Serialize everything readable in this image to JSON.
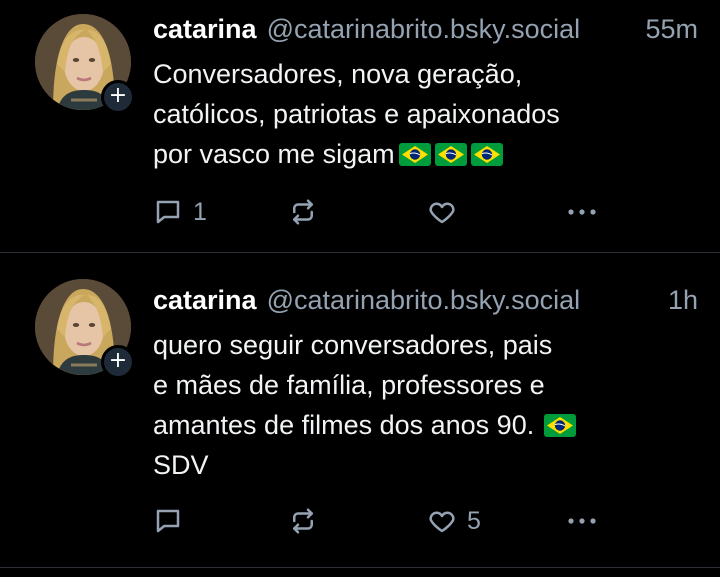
{
  "posts": [
    {
      "author_name": "catarina",
      "handle": "@catarinabrito.bsky.social",
      "time": "55m",
      "text": "Conversadores, nova geração,\ncatólicos, patriotas e apaixonados\npor vasco me sigam",
      "emoji": [
        "🇧🇷",
        "🇧🇷",
        "🇧🇷"
      ],
      "follow_badge": "+",
      "reply_count": "1",
      "repost_count": "",
      "like_count": ""
    },
    {
      "author_name": "catarina",
      "handle": "@catarinabrito.bsky.social",
      "time": "1h",
      "text_lines": [
        "quero seguir conversadores, pais",
        "e mães de família, professores e",
        "amantes de filmes dos anos 90.",
        "SDV"
      ],
      "emoji": [
        "🇧🇷"
      ],
      "follow_badge": "+",
      "reply_count": "",
      "repost_count": "",
      "like_count": "5"
    }
  ],
  "icons": {
    "reply": "reply-icon",
    "repost": "repost-icon",
    "like": "heart-icon",
    "more": "more-icon",
    "flag": "brazil-flag-emoji"
  },
  "colors": {
    "background": "#000000",
    "secondary_text": "#94a2b1",
    "divider": "#2a2f36",
    "flag_green": "#009c3b",
    "flag_yellow": "#ffdf00",
    "flag_blue": "#002776"
  }
}
